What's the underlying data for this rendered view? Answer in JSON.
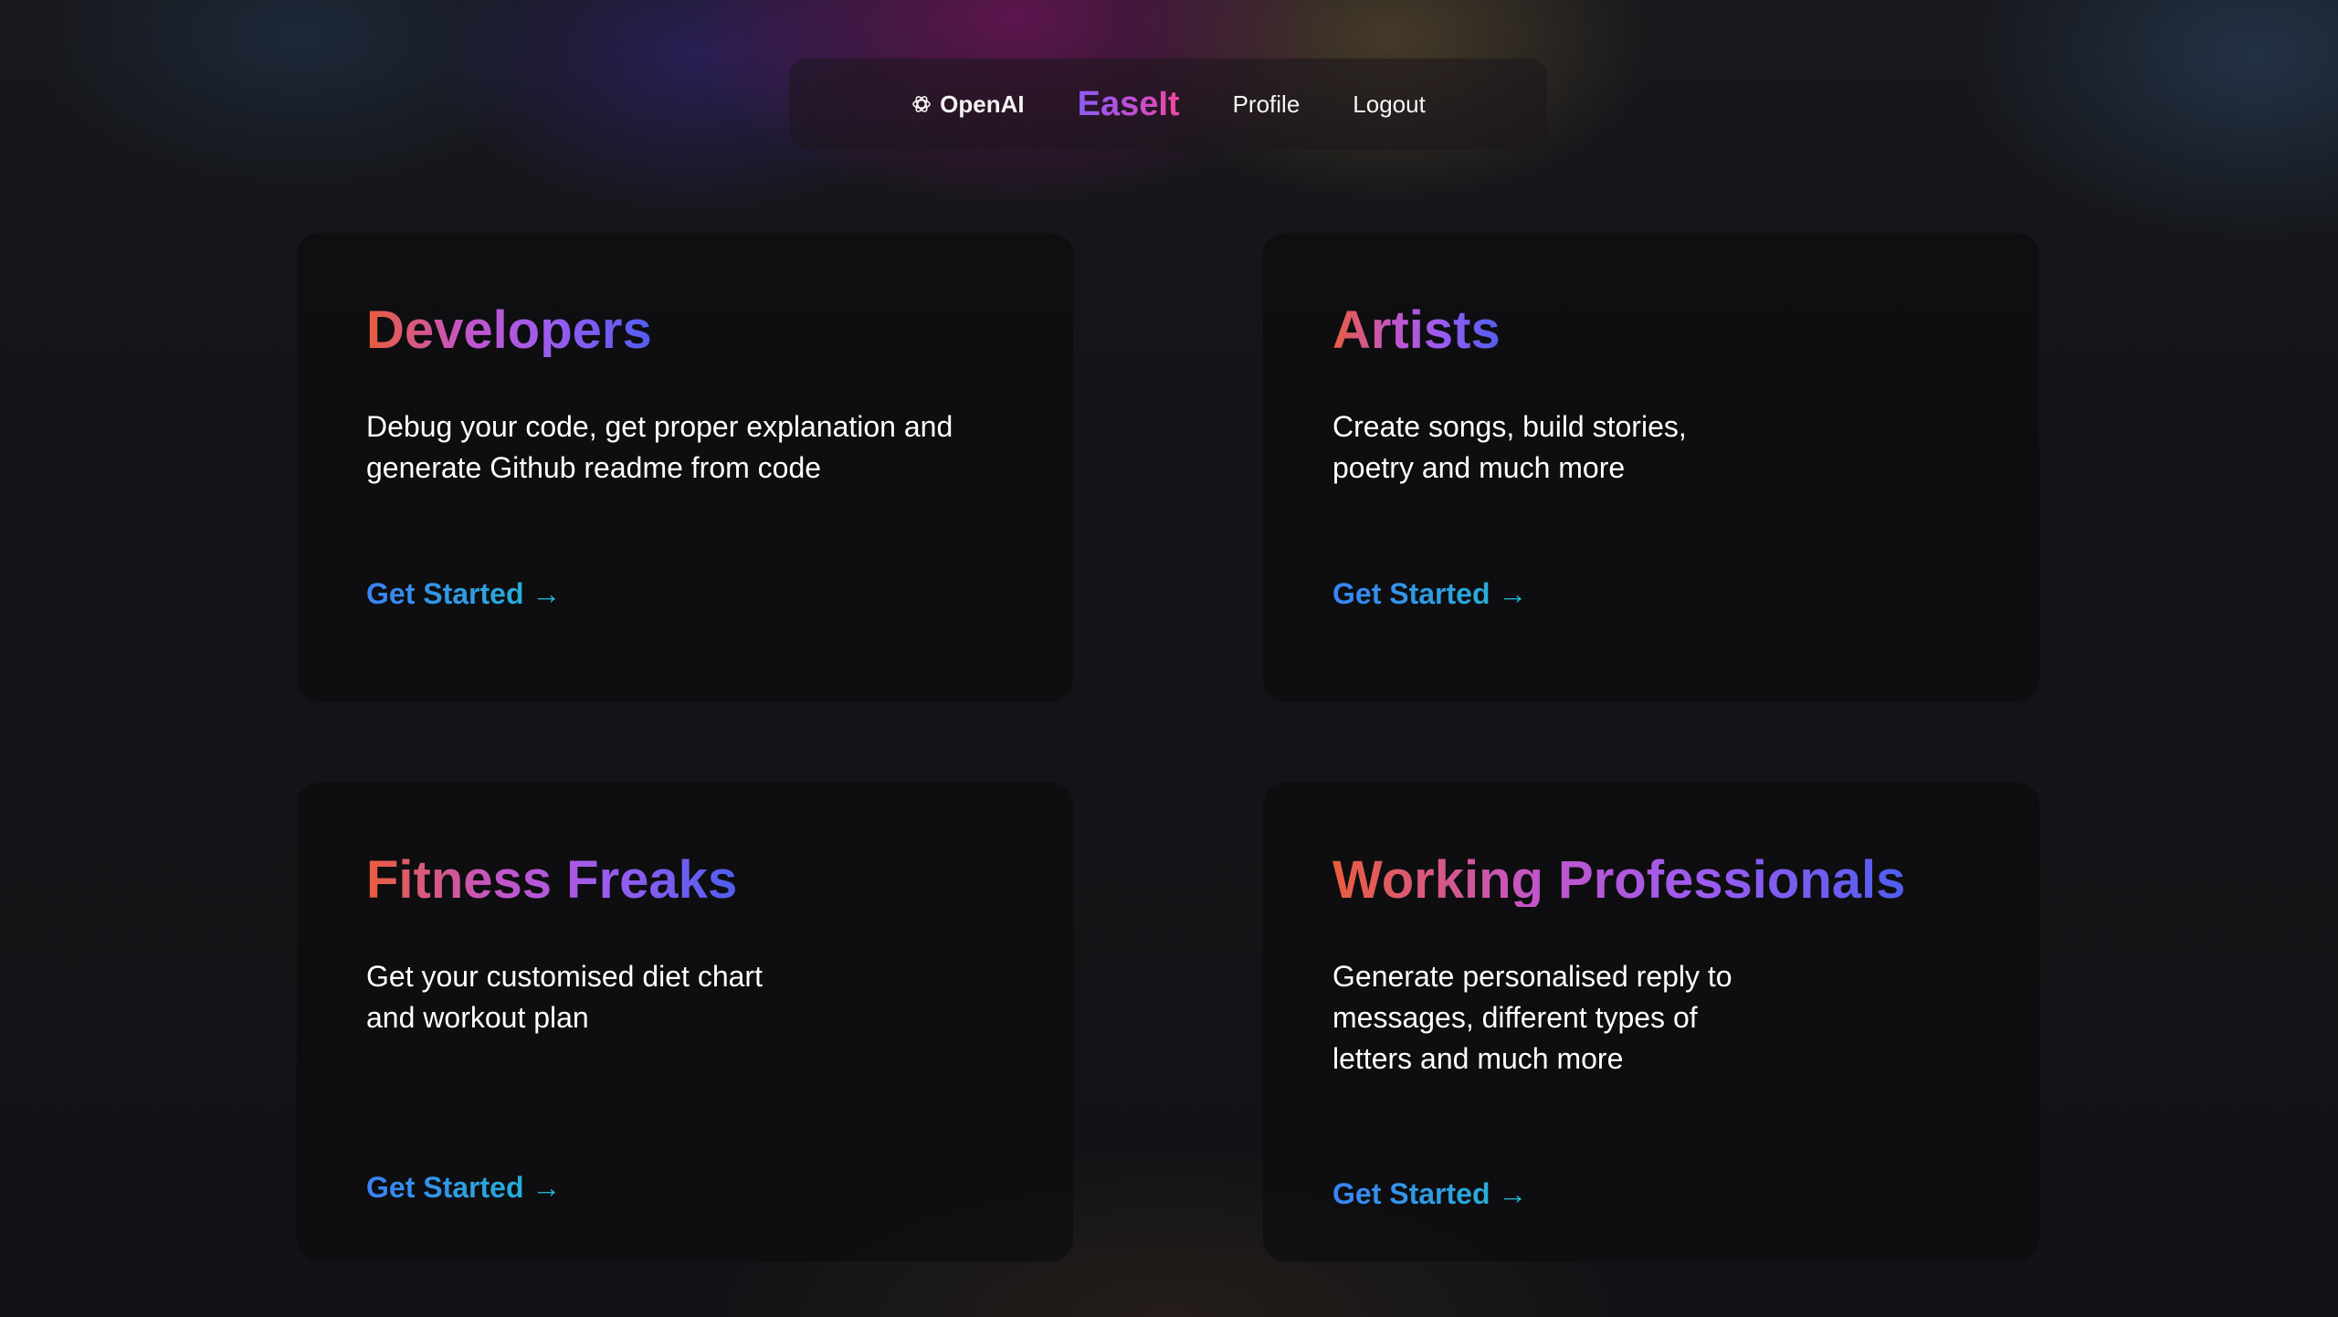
{
  "nav": {
    "logo_icon": "openai-icon",
    "logo_text": "OpenAI",
    "brand": "EaseIt",
    "profile": "Profile",
    "logout": "Logout"
  },
  "cards": [
    {
      "title": "Developers",
      "description": "Debug your code, get proper explanation and\ngenerate Github readme from code",
      "cta": "Get Started →"
    },
    {
      "title": "Artists",
      "description": "Create songs, build stories,\npoetry and much more",
      "cta": "Get Started →"
    },
    {
      "title": "Fitness Freaks",
      "description": "Get your customised diet chart\nand workout plan",
      "cta": "Get Started →"
    },
    {
      "title": "Working Professionals",
      "description": "Generate personalised reply to\nmessages, different types of\nletters and much more",
      "cta": "Get Started →"
    }
  ],
  "colors": {
    "background": "#121316",
    "card": "#0c0c0e",
    "title_gradient": [
      "#ea5d3c",
      "#9b5cf0",
      "#4f5ef0"
    ],
    "cta_gradient": [
      "#3b82f6",
      "#22b8cf"
    ],
    "brand_gradient": [
      "#8b5cf6",
      "#ec4899"
    ]
  }
}
